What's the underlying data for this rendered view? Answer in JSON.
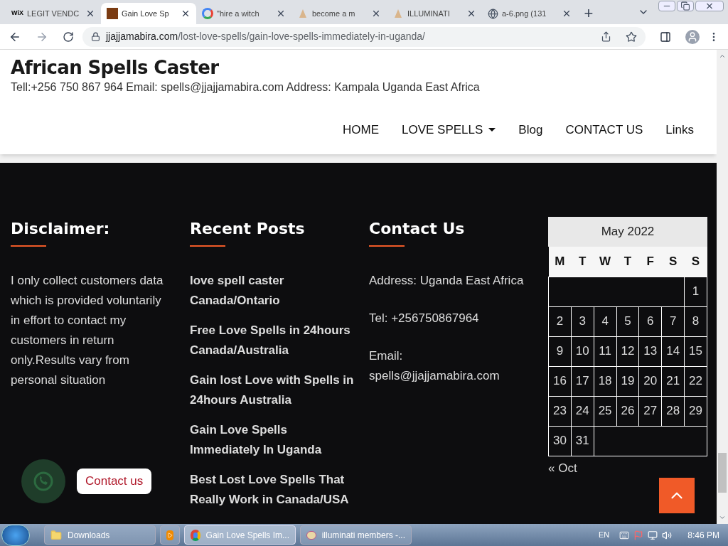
{
  "browser": {
    "tabs": [
      {
        "title": "LEGIT VENDC",
        "logo_text": "WiX",
        "selected": false
      },
      {
        "title": "Gain Love Sp",
        "selected": true
      },
      {
        "title": "\"hire a witch",
        "selected": false
      },
      {
        "title": "become a m",
        "selected": false
      },
      {
        "title": "ILLUMINATI",
        "selected": false
      },
      {
        "title": "a-6.png (131",
        "selected": false
      }
    ],
    "new_tab": "+",
    "url_host": "jjajjamabira.com",
    "url_path": "/lost-love-spells/gain-love-spells-immediately-in-uganda/"
  },
  "header": {
    "site_title": "African Spells Caster",
    "contact_line": "Tell:+256 750 867 964 Email: spells@jjajjamabira.com Address: Kampala Uganda East Africa",
    "nav": [
      {
        "label": "HOME",
        "dropdown": false
      },
      {
        "label": "LOVE SPELLS",
        "dropdown": true
      },
      {
        "label": "Blog",
        "dropdown": false
      },
      {
        "label": "CONTACT US",
        "dropdown": false
      },
      {
        "label": "Links",
        "dropdown": false
      }
    ]
  },
  "footer": {
    "disclaimer": {
      "title": "Disclaimer:",
      "text": "I only collect customers data which is provided voluntarily in effort to contact my customers in return only.Results vary from personal situation"
    },
    "recent_posts": {
      "title": "Recent Posts",
      "posts": [
        "love spell caster Canada/Ontario",
        "Free Love Spells in 24hours Canada/Australia",
        "Gain lost Love with Spells in 24hours Australia",
        "Gain Love Spells Immediately In Uganda",
        "Best Lost Love Spells That Really Work in Canada/USA"
      ]
    },
    "contact": {
      "title": "Contact Us",
      "lines": [
        "Address: Uganda East Africa",
        "Tel: +256750867964",
        "Email: spells@jjajjamabira.com"
      ]
    },
    "calendar": {
      "caption": "May 2022",
      "weekdays": [
        "M",
        "T",
        "W",
        "T",
        "F",
        "S",
        "S"
      ],
      "weeks": [
        {
          "kind": "first",
          "days": [
            "1"
          ]
        },
        {
          "kind": "full",
          "days": [
            "2",
            "3",
            "4",
            "5",
            "6",
            "7",
            "8"
          ]
        },
        {
          "kind": "full",
          "days": [
            "9",
            "10",
            "11",
            "12",
            "13",
            "14",
            "15"
          ]
        },
        {
          "kind": "full",
          "days": [
            "16",
            "17",
            "18",
            "19",
            "20",
            "21",
            "22"
          ]
        },
        {
          "kind": "full",
          "days": [
            "23",
            "24",
            "25",
            "26",
            "27",
            "28",
            "29"
          ]
        },
        {
          "kind": "last",
          "days": [
            "30",
            "31"
          ]
        }
      ],
      "prev_link": "« Oct"
    }
  },
  "whatsapp": {
    "label": "Contact us"
  },
  "taskbar": {
    "items": [
      {
        "label": "Downloads",
        "active": false
      },
      {
        "active": false
      },
      {
        "label": "Gain Love Spells Im...",
        "active": true
      },
      {
        "label": "illuminati members -...",
        "active": false
      }
    ],
    "language": "EN",
    "clock": "8:46 PM"
  }
}
